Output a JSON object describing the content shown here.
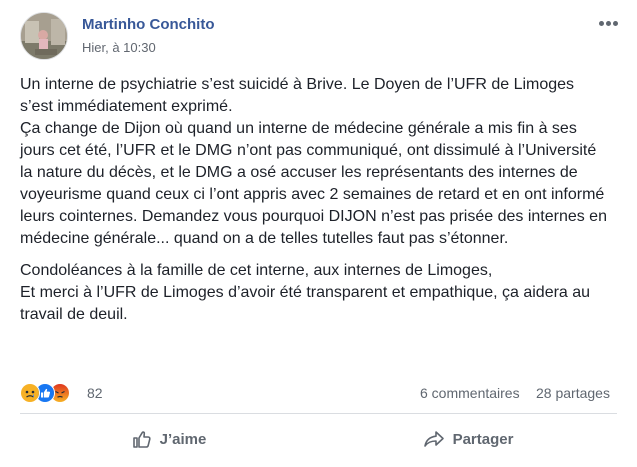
{
  "post": {
    "author": "Martinho Conchito",
    "timestamp": "Hier, à 10:30",
    "paragraphs": [
      "Un interne de psychiatrie s’est suicidé à Brive. Le Doyen de l’UFR de Limoges s’est immédiatement exprimé.\nÇa change de Dijon où quand un interne de médecine générale a mis fin à ses jours cet été, l’UFR et le DMG n’ont pas communiqué, ont dissimulé à l’Université la nature du décès, et le DMG a osé accuser les représentants des internes de voyeurisme quand ceux ci l’ont appris avec 2 semaines de retard et en ont informé leurs cointernes. Demandez vous pourquoi DIJON n’est pas prisée des internes en médecine générale... quand on a de telles tutelles faut pas s’étonner.",
      "Condoléances à la famille de cet interne, aux internes de Limoges,\nEt merci à l’UFR de Limoges d’avoir été transparent et empathique, ça aidera au travail de deuil."
    ]
  },
  "reactions": {
    "icons": [
      "sad-reaction-icon",
      "like-reaction-icon",
      "angry-reaction-icon"
    ],
    "count": "82",
    "comments": "6 commentaires",
    "shares": "28 partages"
  },
  "actions": {
    "like_label": "J’aime",
    "share_label": "Partager"
  },
  "colors": {
    "author_link": "#385898",
    "secondary_text": "#606770",
    "like_blue": "#1877f2",
    "angry_red": "#e9710f",
    "sad_yellow": "#f7b125"
  }
}
